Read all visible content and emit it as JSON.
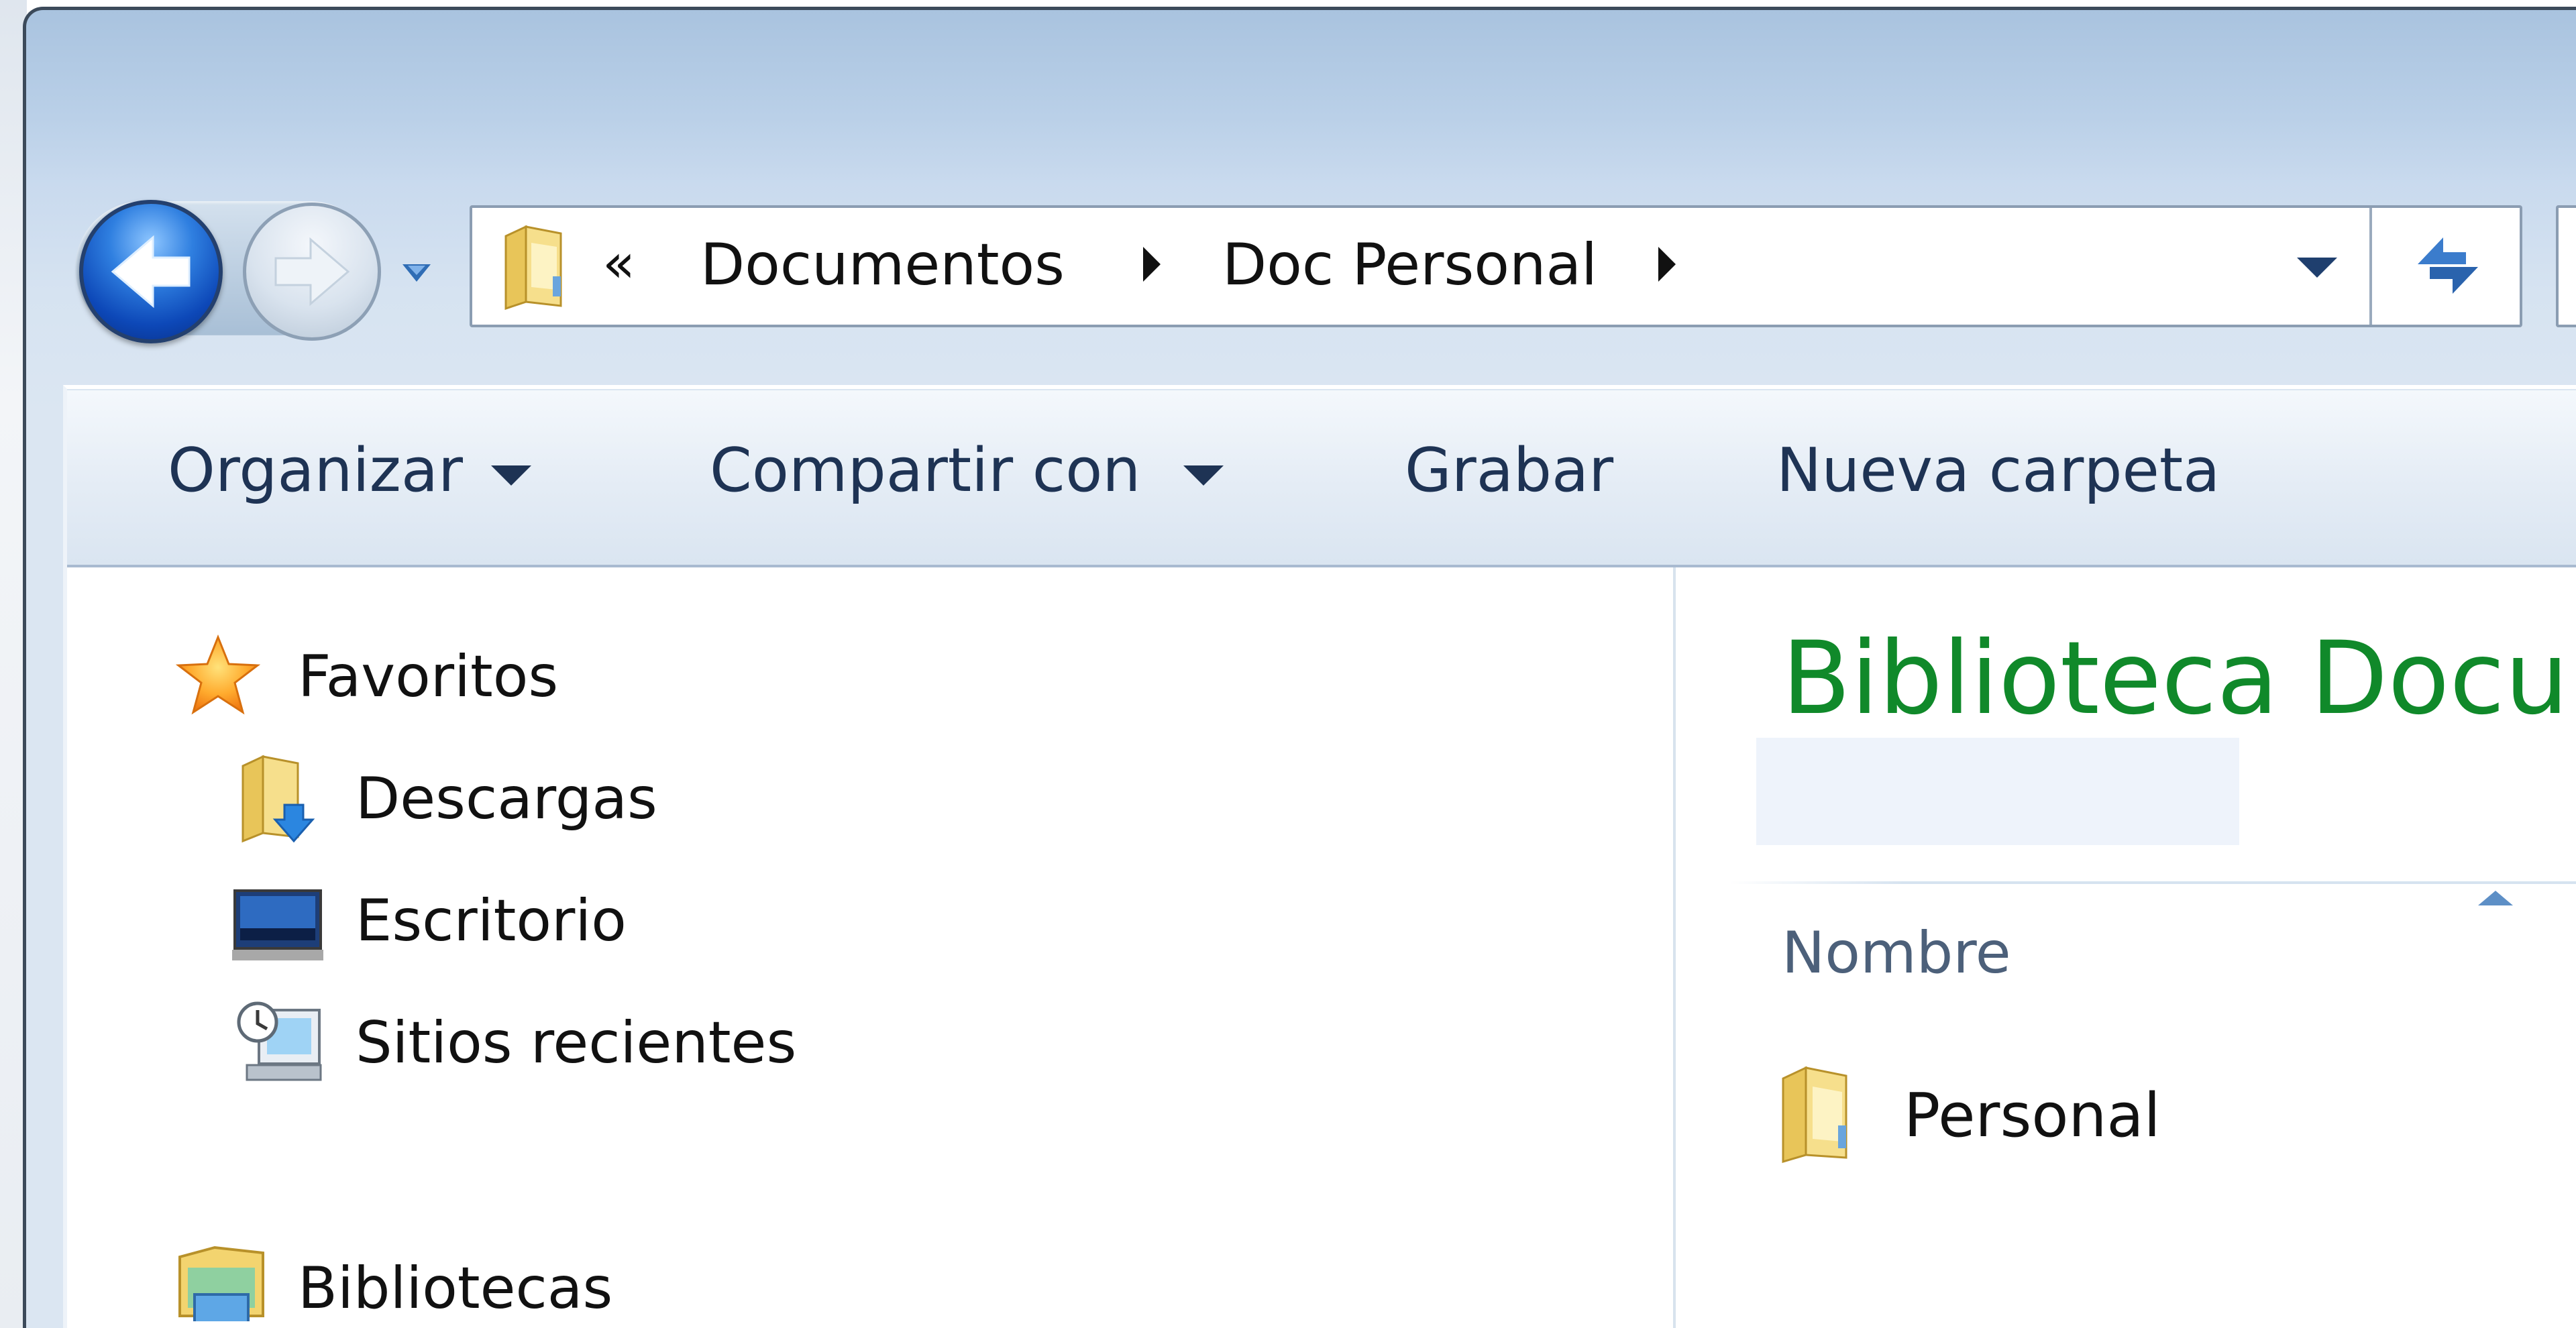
{
  "address_bar": {
    "overflow_chevron": "«",
    "crumbs": [
      "Documentos",
      "Doc Personal"
    ]
  },
  "toolbar": {
    "organize": "Organizar",
    "share": "Compartir con",
    "burn": "Grabar",
    "new_folder": "Nueva carpeta"
  },
  "nav_pane": {
    "favorites": "Favoritos",
    "items": [
      "Descargas",
      "Escritorio",
      "Sitios recientes"
    ],
    "libraries": "Bibliotecas"
  },
  "content": {
    "title": "Biblioteca Docum",
    "column_name": "Nombre",
    "files": [
      {
        "name": "Personal",
        "icon": "folder-icon"
      }
    ]
  },
  "icons": {
    "back": "back-arrow-icon",
    "forward": "forward-arrow-icon",
    "refresh": "refresh-icon",
    "favorites": "star-icon"
  },
  "colors": {
    "library_title": "#10892a",
    "toolbar_text": "#1e3354"
  }
}
